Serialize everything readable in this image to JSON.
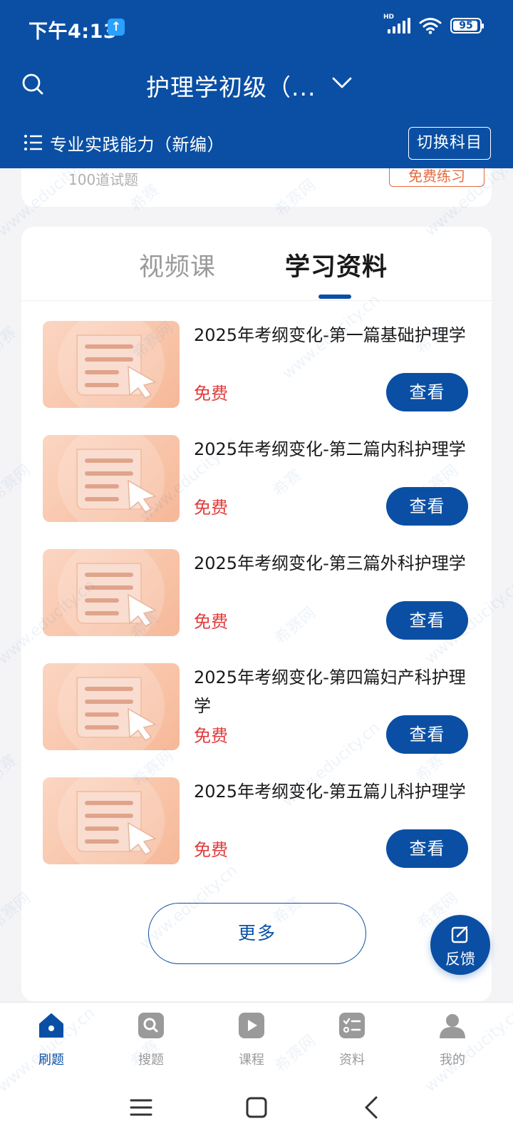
{
  "status": {
    "time": "下午4:13",
    "network": "HD",
    "battery": "95"
  },
  "header": {
    "title": "护理学初级（...",
    "subject": "专业实践能力（新编）",
    "switch_label": "切换科目"
  },
  "prev_card": {
    "count": "100道试题",
    "badge": "免费练习"
  },
  "tabs": [
    {
      "label": "视频课",
      "active": false
    },
    {
      "label": "学习资料",
      "active": true
    }
  ],
  "materials": [
    {
      "title": "2025年考纲变化-第一篇基础护理学",
      "price": "免费",
      "action": "查看"
    },
    {
      "title": "2025年考纲变化-第二篇内科护理学",
      "price": "免费",
      "action": "查看"
    },
    {
      "title": "2025年考纲变化-第三篇外科护理学",
      "price": "免费",
      "action": "查看"
    },
    {
      "title": "2025年考纲变化-第四篇妇产科护理学",
      "price": "免费",
      "action": "查看"
    },
    {
      "title": "2025年考纲变化-第五篇儿科护理学",
      "price": "免费",
      "action": "查看"
    }
  ],
  "more_label": "更多",
  "feedback_label": "反馈",
  "nav": [
    {
      "label": "刷题",
      "icon": "home-icon",
      "active": true
    },
    {
      "label": "搜题",
      "icon": "search-icon",
      "active": false
    },
    {
      "label": "课程",
      "icon": "play-icon",
      "active": false
    },
    {
      "label": "资料",
      "icon": "document-list-icon",
      "active": false
    },
    {
      "label": "我的",
      "icon": "user-icon",
      "active": false
    }
  ],
  "colors": {
    "brand": "#0a4fa4",
    "price": "#e23b3b",
    "badge": "#e66a3c"
  },
  "watermark": {
    "domain": "www.educity.cn",
    "brand": "希赛",
    "brand_alt": "希赛网"
  }
}
